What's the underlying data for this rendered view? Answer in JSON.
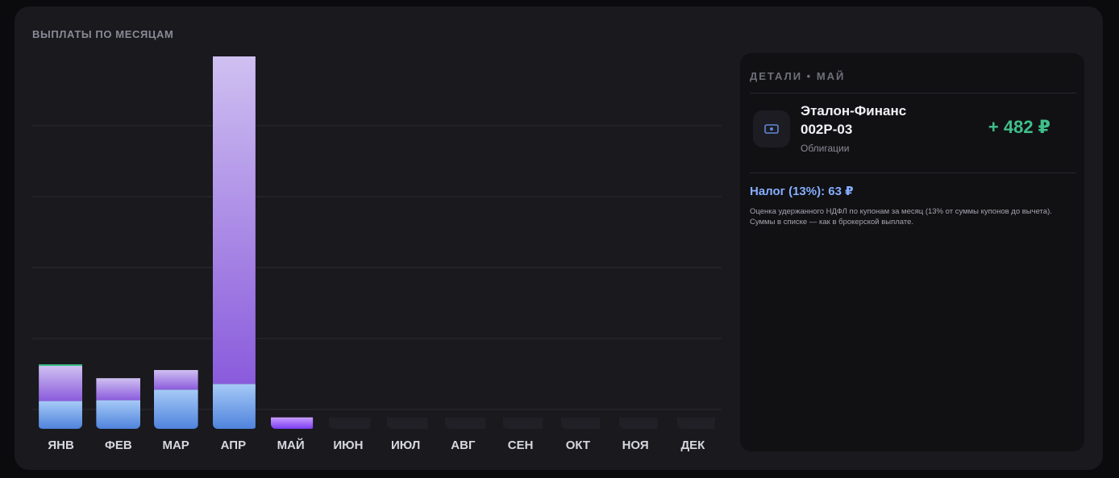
{
  "section_title": "ВЫПЛАТЫ ПО МЕСЯЦАМ",
  "chart_data": {
    "type": "bar",
    "stacked": true,
    "categories": [
      "ЯНВ",
      "ФЕВ",
      "МАР",
      "АПР",
      "МАЙ",
      "ИЮН",
      "ИЮЛ",
      "АВГ",
      "СЕН",
      "ОКТ",
      "НОЯ",
      "ДЕК"
    ],
    "series": [
      {
        "color": "#5b8fe0",
        "values": [
          34,
          35,
          48,
          55,
          0,
          0,
          0,
          0,
          0,
          0,
          0,
          0
        ]
      },
      {
        "color": "#9b6be6",
        "values": [
          43,
          27,
          24,
          401,
          14,
          0,
          0,
          0,
          0,
          0,
          0,
          0
        ]
      },
      {
        "color": "#3fc08a",
        "values": [
          2,
          0,
          0,
          0,
          0,
          0,
          0,
          0,
          0,
          0,
          0,
          0
        ]
      }
    ],
    "ylim": [
      0,
      456
    ],
    "grid": true,
    "selected": "МАЙ"
  },
  "details": {
    "title": "ДЕТАЛИ • МАЙ",
    "item": {
      "icon": "cash-icon",
      "name": "Эталон-Финанс 002Р-03",
      "type": "Облигации",
      "amount": "+ 482 ₽"
    },
    "tax_line": "Налог (13%): 63 ₽",
    "tax_note": "Оценка удержанного НДФЛ по купонам за месяц (13% от суммы купонов до вычета). Суммы в списке — как в брокерской выплате."
  },
  "colors": {
    "background": "#19191e",
    "panel": "#111114",
    "accent_green": "#3fc08a",
    "accent_blue": "#86aeff"
  }
}
